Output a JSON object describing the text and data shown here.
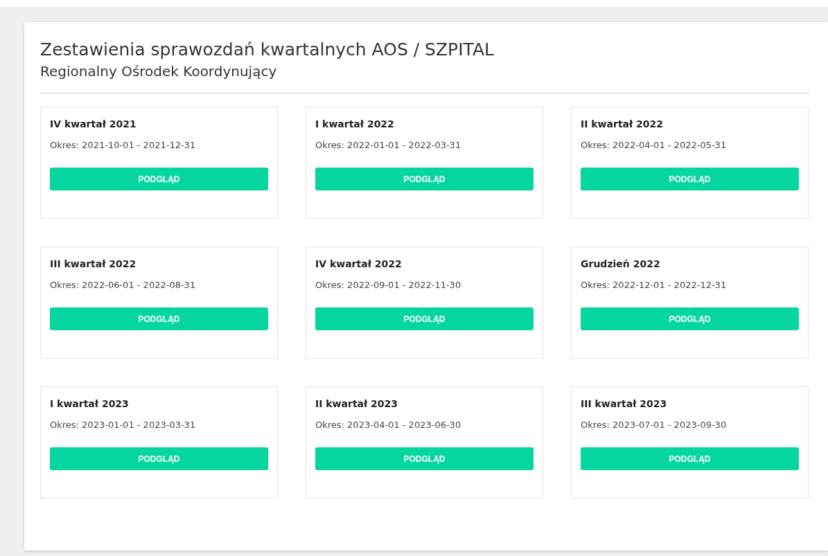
{
  "header": {
    "title": "Zestawienia sprawozdań kwartalnych AOS / SZPITAL",
    "subtitle": "Regionalny Ośrodek Koordynujący"
  },
  "reports": [
    {
      "title": "IV kwartał 2021",
      "period": "Okres: 2021-10-01 - 2021-12-31",
      "button": "PODGLĄD"
    },
    {
      "title": "I kwartał 2022",
      "period": "Okres: 2022-01-01 - 2022-03-31",
      "button": "PODGLĄD"
    },
    {
      "title": "II kwartał 2022",
      "period": "Okres: 2022-04-01 - 2022-05-31",
      "button": "PODGLĄD"
    },
    {
      "title": "III kwartał 2022",
      "period": "Okres: 2022-06-01 - 2022-08-31",
      "button": "PODGLĄD"
    },
    {
      "title": "IV kwartał 2022",
      "period": "Okres: 2022-09-01 - 2022-11-30",
      "button": "PODGLĄD"
    },
    {
      "title": "Grudzień 2022",
      "period": "Okres: 2022-12-01 - 2022-12-31",
      "button": "PODGLĄD"
    },
    {
      "title": "I kwartał 2023",
      "period": "Okres: 2023-01-01 - 2023-03-31",
      "button": "PODGLĄD"
    },
    {
      "title": "II kwartał 2023",
      "period": "Okres: 2023-04-01 - 2023-06-30",
      "button": "PODGLĄD"
    },
    {
      "title": "III kwartał 2023",
      "period": "Okres: 2023-07-01 - 2023-09-30",
      "button": "PODGLĄD"
    }
  ]
}
